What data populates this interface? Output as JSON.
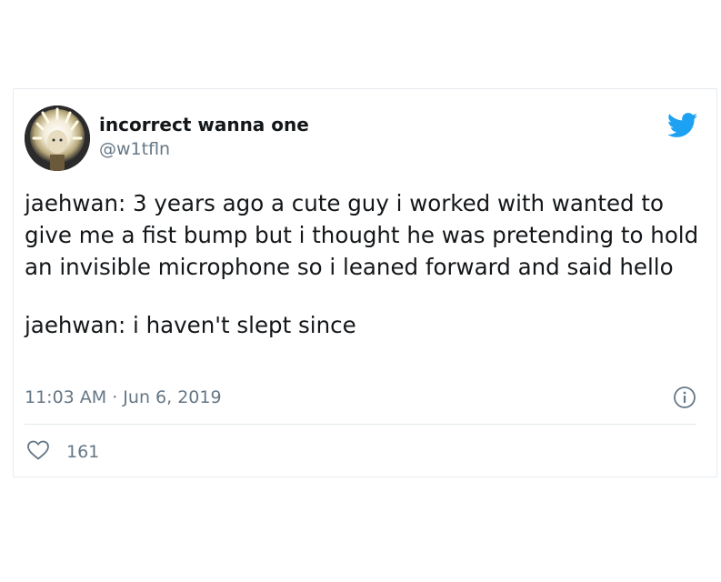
{
  "tweet": {
    "author_name": "incorrect wanna one",
    "author_handle": "@w1tfln",
    "paragraphs": [
      "jaehwan: 3 years ago a cute guy i worked with wanted to give me a fist bump but i thought he was pretending to hold an invisible microphone so i leaned forward and said hello",
      "jaehwan: i haven't slept since"
    ],
    "timestamp": "11:03 AM · Jun 6, 2019",
    "like_count": "161"
  },
  "icons": {
    "brand": "twitter-bird-icon",
    "info": "info-icon",
    "like": "heart-icon"
  },
  "colors": {
    "brand_blue": "#1da1f2",
    "secondary_text": "#657786",
    "primary_text": "#14171a",
    "border": "#e6ecf0"
  }
}
